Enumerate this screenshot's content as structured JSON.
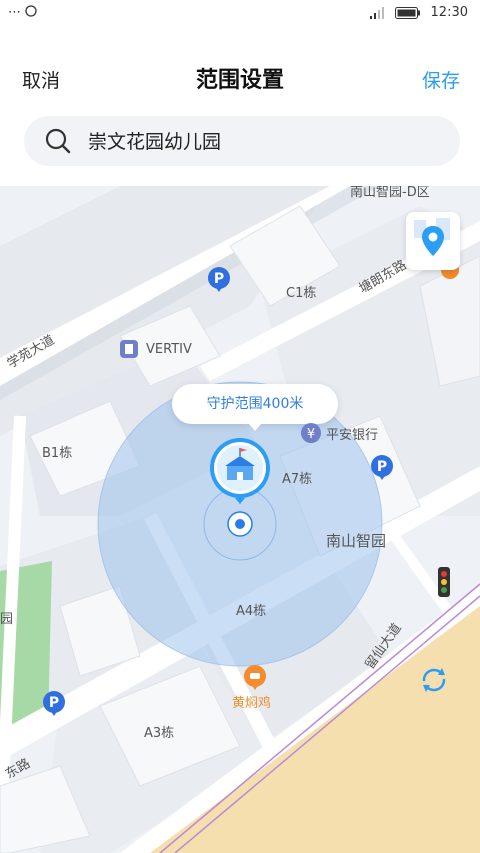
{
  "status_bar": {
    "left_icons": "⋯",
    "time": "12:30"
  },
  "header": {
    "cancel_label": "取消",
    "title": "范围设置",
    "save_label": "保存"
  },
  "search": {
    "value": "崇文花园幼儿园"
  },
  "map": {
    "callout": "守护范围400米",
    "labels": {
      "nanshan_d": "南山智园-D区",
      "c1": "C1栋",
      "tanglang_road": "塘朗东路",
      "xueyuan_road": "学苑大道",
      "vertiv": "VERTIV",
      "b1": "B1栋",
      "pingan": "平安银行",
      "a7": "A7栋",
      "nanshan_zhiyuan": "南山智园",
      "a4": "A4栋",
      "liuxian_road": "留仙大道",
      "huangmenji": "黄焖鸡",
      "a3": "A3栋",
      "east_road": "东路",
      "yuan": "园"
    },
    "icons": {
      "school": "school-icon",
      "parking": "parking-icon",
      "bank": "bank-icon",
      "restaurant": "restaurant-icon",
      "building": "building-icon",
      "traffic_light": "traffic-light-icon",
      "locate": "location-pin-icon",
      "refresh": "refresh-icon"
    },
    "colors": {
      "accent": "#2a9ef4",
      "range_fill": "#9fc2ec",
      "park": "#a6d9a6",
      "road_yellow": "#f5dfae"
    }
  }
}
